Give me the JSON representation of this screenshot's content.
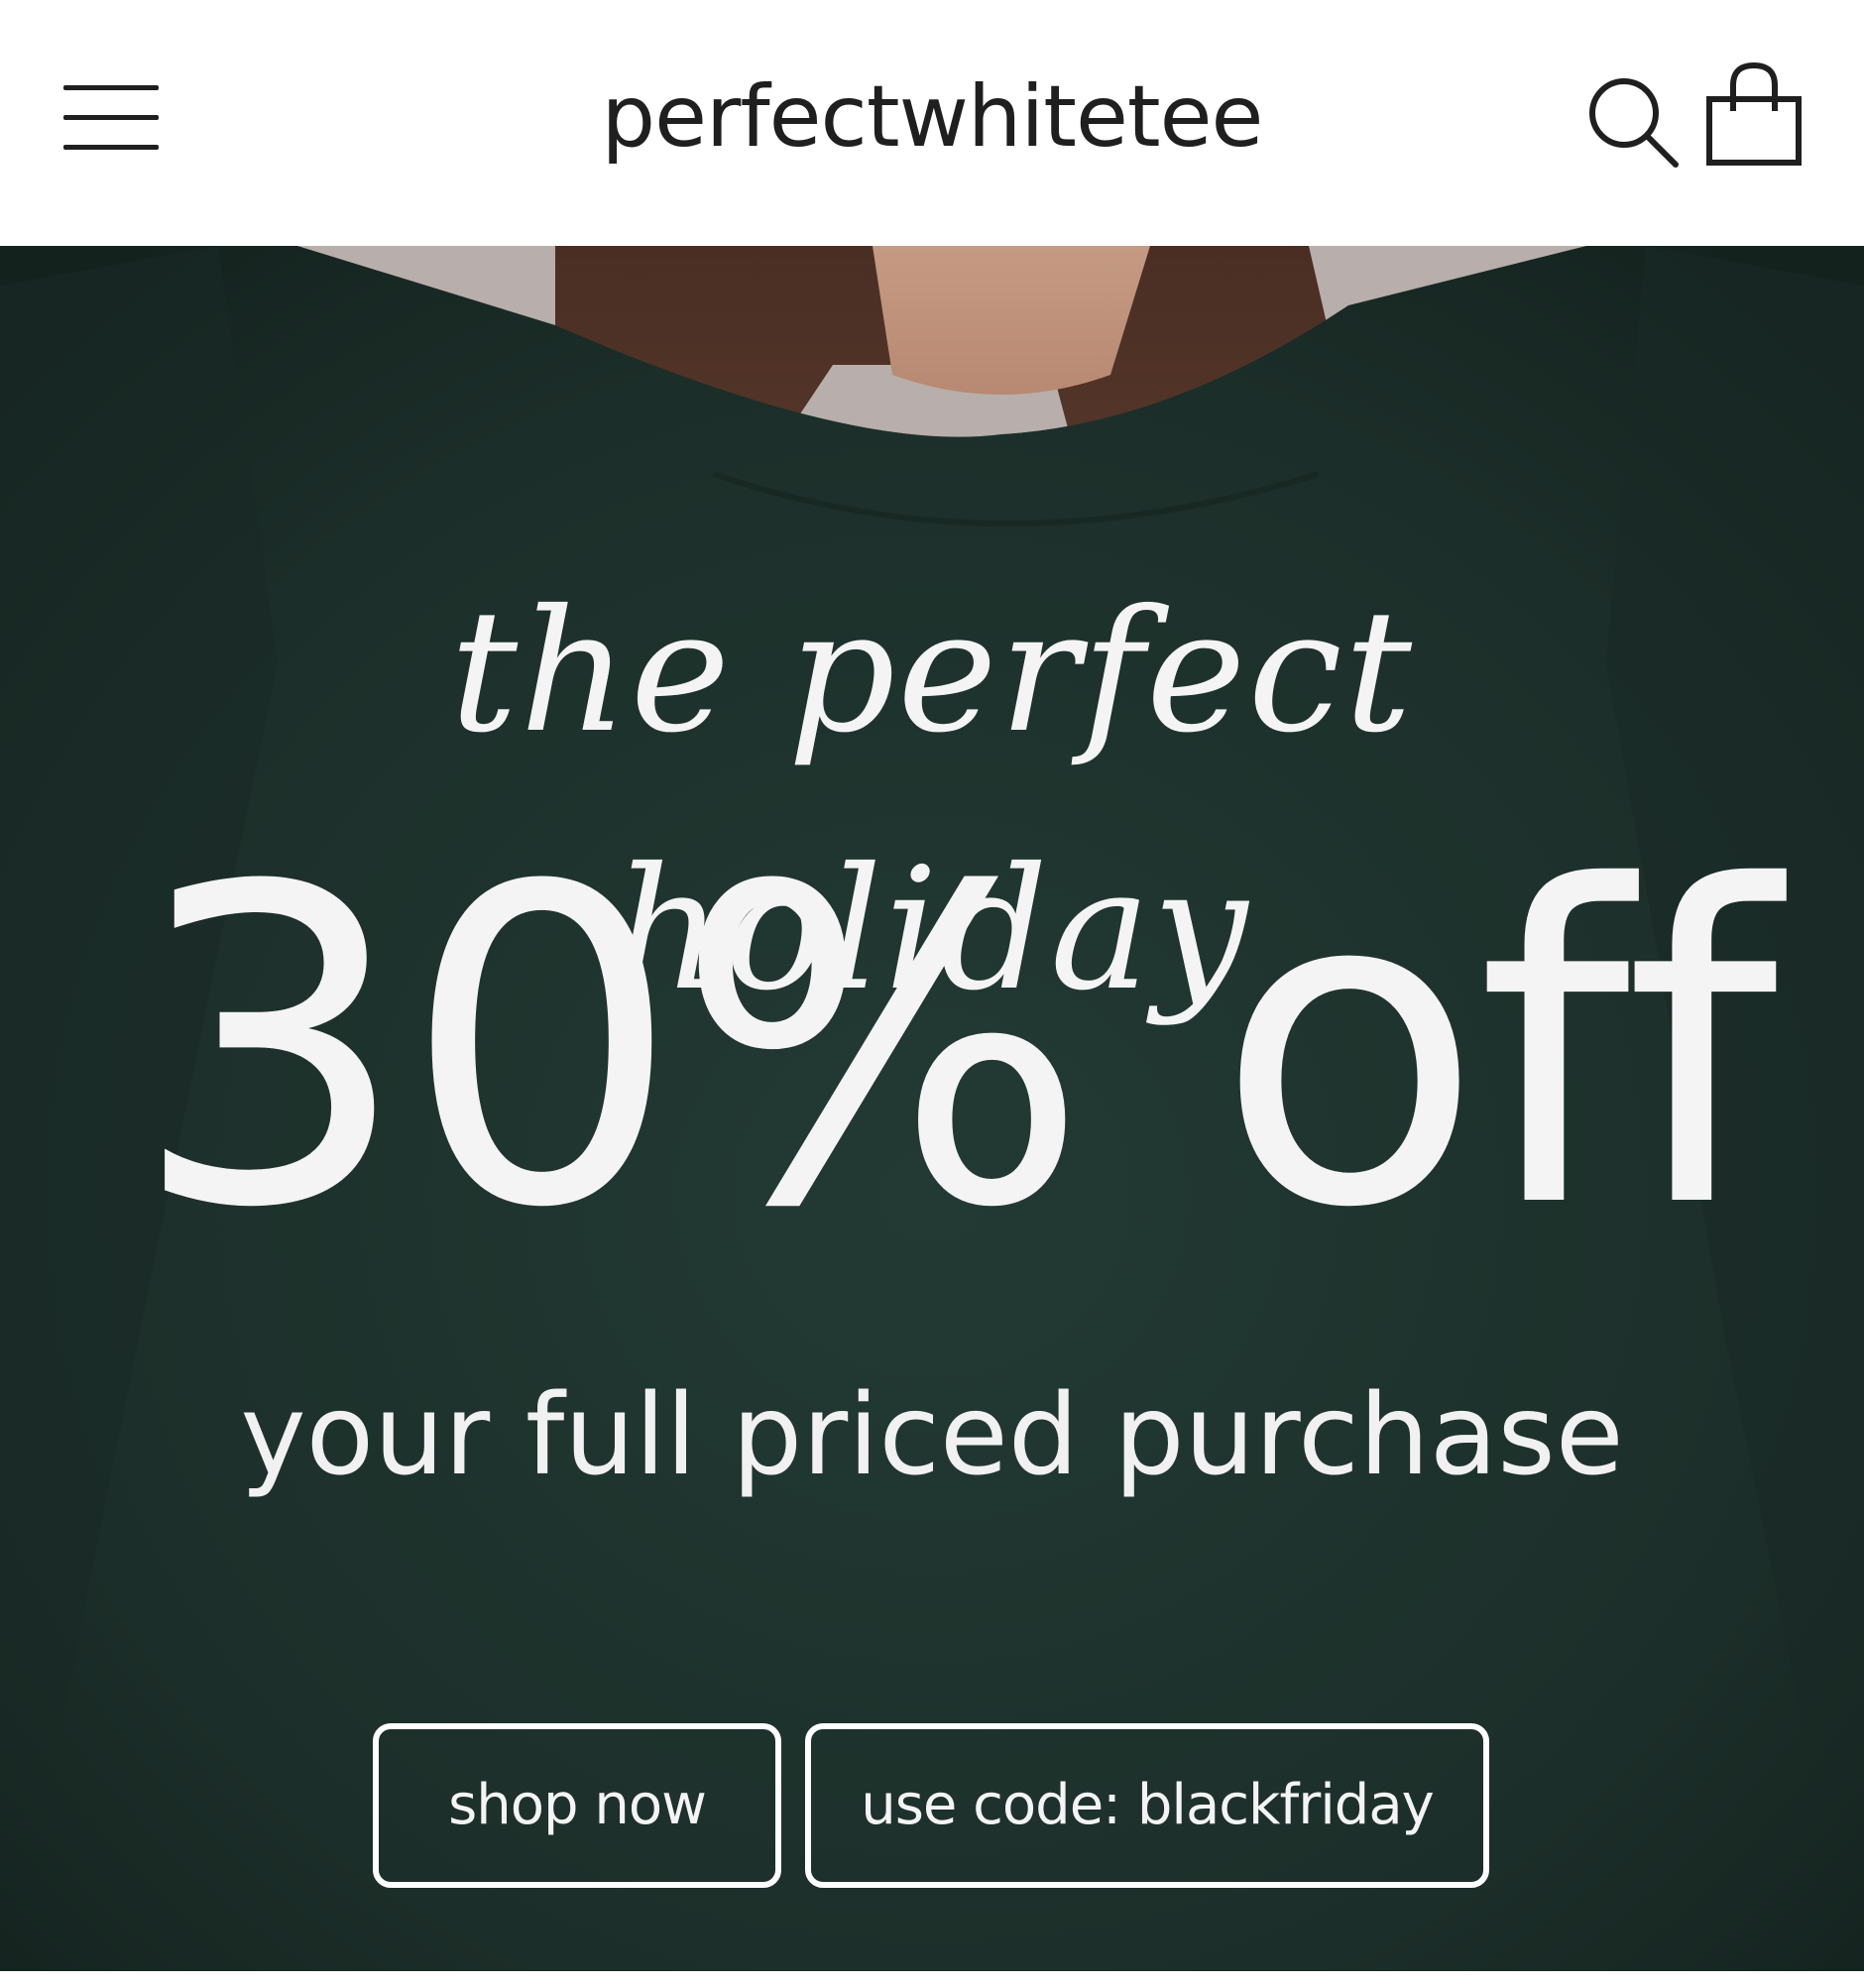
{
  "header": {
    "brand": "perfectwhitetee",
    "icons": {
      "menu": "hamburger-menu-icon",
      "search": "search-icon",
      "cart": "shopping-bag-icon"
    }
  },
  "hero": {
    "script_text": "the perfect holiday",
    "headline": "30% off",
    "subheadline": "your full priced purchase",
    "buttons": {
      "shop_now": "shop now",
      "promo_code": "use code: blackfriday"
    },
    "colors": {
      "sweater": "#1f302b",
      "text": "#f4f4f4",
      "backdrop": "#b8aeab"
    }
  }
}
